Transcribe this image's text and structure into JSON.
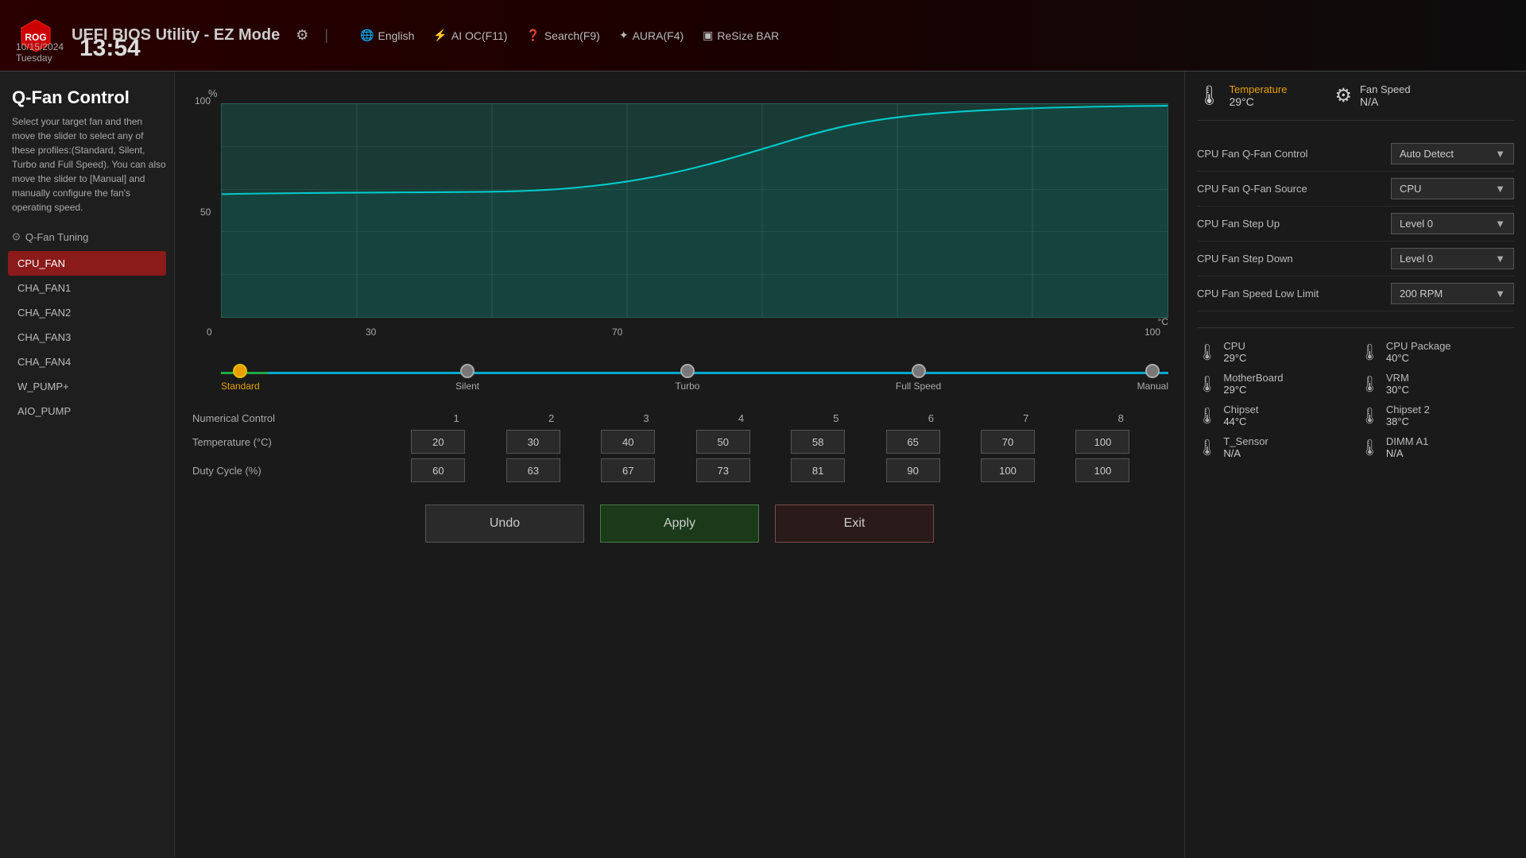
{
  "header": {
    "logo_alt": "ROG",
    "title": "UEFI BIOS Utility - EZ Mode",
    "settings_icon": "⚙",
    "separator": "|",
    "nav_items": [
      {
        "icon": "🌐",
        "label": "English"
      },
      {
        "icon": "⚡",
        "label": "AI OC(F11)"
      },
      {
        "icon": "?",
        "label": "Search(F9)"
      },
      {
        "icon": "✦",
        "label": "AURA(F4)"
      },
      {
        "icon": "▣",
        "label": "ReSize BAR"
      }
    ],
    "date": "10/15/2024",
    "day": "Tuesday",
    "time": "13:54"
  },
  "page": {
    "title": "Q-Fan Control",
    "description": "Select your target fan and then move the slider to select any of these profiles:(Standard, Silent, Turbo and Full Speed). You can also move the slider to [Manual] and manually configure the fan's operating speed."
  },
  "qfan_tuning": {
    "label": "Q-Fan Tuning"
  },
  "fan_list": [
    {
      "id": "cpu_fan",
      "label": "CPU_FAN",
      "active": true
    },
    {
      "id": "cha_fan1",
      "label": "CHA_FAN1",
      "active": false
    },
    {
      "id": "cha_fan2",
      "label": "CHA_FAN2",
      "active": false
    },
    {
      "id": "cha_fan3",
      "label": "CHA_FAN3",
      "active": false
    },
    {
      "id": "cha_fan4",
      "label": "CHA_FAN4",
      "active": false
    },
    {
      "id": "w_pump",
      "label": "W_PUMP+",
      "active": false
    },
    {
      "id": "aio_pump",
      "label": "AIO_PUMP",
      "active": false
    }
  ],
  "chart": {
    "y_label": "%",
    "y_100": "100",
    "y_50": "50",
    "x_unit": "°C",
    "x_labels": [
      "0",
      "30",
      "70",
      "100"
    ],
    "x_positions": [
      0,
      30,
      70,
      100
    ]
  },
  "slider": {
    "points": [
      {
        "id": "standard",
        "label": "Standard",
        "active": true
      },
      {
        "id": "silent",
        "label": "Silent",
        "active": false
      },
      {
        "id": "turbo",
        "label": "Turbo",
        "active": false
      },
      {
        "id": "full_speed",
        "label": "Full Speed",
        "active": false
      },
      {
        "id": "manual",
        "label": "Manual",
        "active": false
      }
    ]
  },
  "numerical_control": {
    "title": "Numerical Control",
    "columns": [
      "1",
      "2",
      "3",
      "4",
      "5",
      "6",
      "7",
      "8"
    ],
    "temperature_label": "Temperature (°C)",
    "temperature_values": [
      "20",
      "30",
      "40",
      "50",
      "58",
      "65",
      "70",
      "100"
    ],
    "duty_cycle_label": "Duty Cycle (%)",
    "duty_cycle_values": [
      "60",
      "63",
      "67",
      "73",
      "81",
      "90",
      "100",
      "100"
    ]
  },
  "buttons": {
    "undo": "Undo",
    "apply": "Apply",
    "exit": "Exit"
  },
  "right_panel": {
    "temperature_label": "Temperature",
    "temperature_value": "29°C",
    "fan_speed_label": "Fan Speed",
    "fan_speed_value": "N/A",
    "settings": [
      {
        "label": "CPU Fan Q-Fan Control",
        "value": "Auto Detect"
      },
      {
        "label": "CPU Fan Q-Fan Source",
        "value": "CPU"
      },
      {
        "label": "CPU Fan Step Up",
        "value": "Level 0"
      },
      {
        "label": "CPU Fan Step Down",
        "value": "Level 0"
      },
      {
        "label": "CPU Fan Speed Low Limit",
        "value": "200 RPM"
      }
    ],
    "sensors": [
      {
        "name": "CPU",
        "temp": "29°C"
      },
      {
        "name": "CPU Package",
        "temp": "40°C"
      },
      {
        "name": "MotherBoard",
        "temp": "29°C"
      },
      {
        "name": "VRM",
        "temp": "30°C"
      },
      {
        "name": "Chipset",
        "temp": "44°C"
      },
      {
        "name": "Chipset 2",
        "temp": "38°C"
      },
      {
        "name": "T_Sensor",
        "temp": "N/A"
      },
      {
        "name": "DIMM A1",
        "temp": "N/A"
      }
    ]
  }
}
